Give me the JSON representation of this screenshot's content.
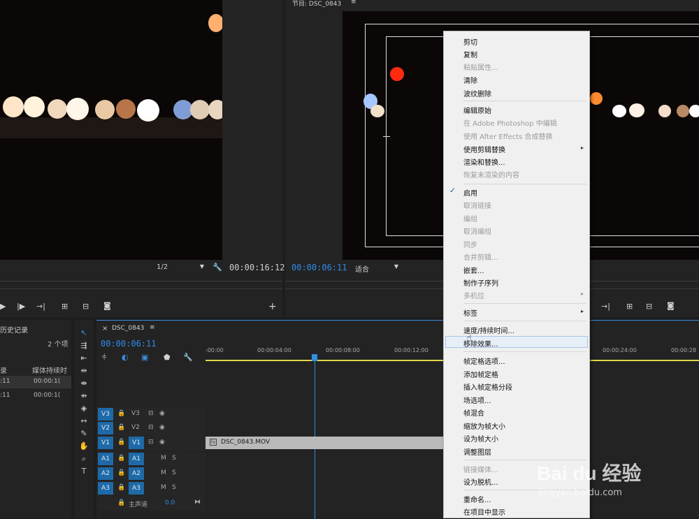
{
  "source_monitor": {
    "resolution": "1/2",
    "timecode": "00:00:16:12"
  },
  "program_monitor": {
    "title": "节目: DSC_0843",
    "timecode": "00:00:06:11",
    "fit": "适合"
  },
  "project_panel": {
    "tab_label": "历史记录",
    "item_count": "2 个项",
    "col_name": "录",
    "col_duration": "媒体持续时",
    "rows": [
      {
        "name": ":11",
        "duration": "00:00:1("
      },
      {
        "name": ":11",
        "duration": "00:00:1("
      }
    ]
  },
  "timeline": {
    "close": "×",
    "tab_label": "DSC_0843",
    "timecode": "00:00:06:11",
    "ruler_ticks": [
      ":00:00",
      "00:00:04:00",
      "00:00:08:00",
      "00:00:12:00",
      "00:00:24:00",
      "00:00:28"
    ],
    "clip_label": "DSC_0843.MOV",
    "video_tracks": [
      {
        "src": "V3",
        "dst": "V3"
      },
      {
        "src": "V2",
        "dst": "V2"
      },
      {
        "src": "V1",
        "dst": "V1"
      }
    ],
    "audio_tracks": [
      {
        "src": "A1",
        "dst": "A1",
        "m": "M",
        "s": "S"
      },
      {
        "src": "A2",
        "dst": "A2",
        "m": "M",
        "s": "S"
      },
      {
        "src": "A3",
        "dst": "A3",
        "m": "M",
        "s": "S"
      }
    ],
    "master": {
      "label": "主声道",
      "value": "0.0"
    }
  },
  "context_menu": {
    "items": [
      {
        "label": "剪切",
        "enabled": true
      },
      {
        "label": "复制",
        "enabled": true
      },
      {
        "label": "粘贴属性...",
        "enabled": false
      },
      {
        "label": "清除",
        "enabled": true
      },
      {
        "label": "波纹删除",
        "enabled": true
      },
      {
        "label": "编辑原始",
        "enabled": true
      },
      {
        "label": "在 Adobe Photoshop 中编辑",
        "enabled": false
      },
      {
        "label": "使用 After Effects 合成替换",
        "enabled": false
      },
      {
        "label": "使用剪辑替换",
        "enabled": true,
        "submenu": true
      },
      {
        "label": "渲染和替换...",
        "enabled": true
      },
      {
        "label": "恢复未渲染的内容",
        "enabled": false
      },
      {
        "label": "启用",
        "enabled": true,
        "checked": true
      },
      {
        "label": "取消链接",
        "enabled": false
      },
      {
        "label": "编组",
        "enabled": false
      },
      {
        "label": "取消编组",
        "enabled": false
      },
      {
        "label": "同步",
        "enabled": false
      },
      {
        "label": "合并剪辑...",
        "enabled": false
      },
      {
        "label": "嵌套...",
        "enabled": true
      },
      {
        "label": "制作子序列",
        "enabled": true
      },
      {
        "label": "多机位",
        "enabled": false,
        "submenu": true
      },
      {
        "label": "标签",
        "enabled": true,
        "submenu": true
      },
      {
        "label": "速度/持续时间...",
        "enabled": true
      },
      {
        "label": "移除效果...",
        "enabled": true,
        "highlighted": true
      },
      {
        "label": "帧定格选项...",
        "enabled": true
      },
      {
        "label": "添加帧定格",
        "enabled": true
      },
      {
        "label": "插入帧定格分段",
        "enabled": true
      },
      {
        "label": "场选项...",
        "enabled": true
      },
      {
        "label": "帧混合",
        "enabled": true
      },
      {
        "label": "缩放为帧大小",
        "enabled": true
      },
      {
        "label": "设为帧大小",
        "enabled": true
      },
      {
        "label": "调整图层",
        "enabled": true
      },
      {
        "label": "链接媒体...",
        "enabled": false
      },
      {
        "label": "设为脱机...",
        "enabled": true
      },
      {
        "label": "重命名...",
        "enabled": true
      },
      {
        "label": "在项目中显示",
        "enabled": true
      }
    ],
    "check_glyph": "✓",
    "submenu_glyph": "▸"
  },
  "watermark": {
    "brand": "Bai du 经验",
    "url": "jingyan.baidu.com"
  },
  "colors": {
    "accent_blue": "#2d8ceb",
    "track_blue": "#1e6aa8",
    "menu_bg": "#f0f0f0",
    "playhead": "#2f8fe0"
  }
}
